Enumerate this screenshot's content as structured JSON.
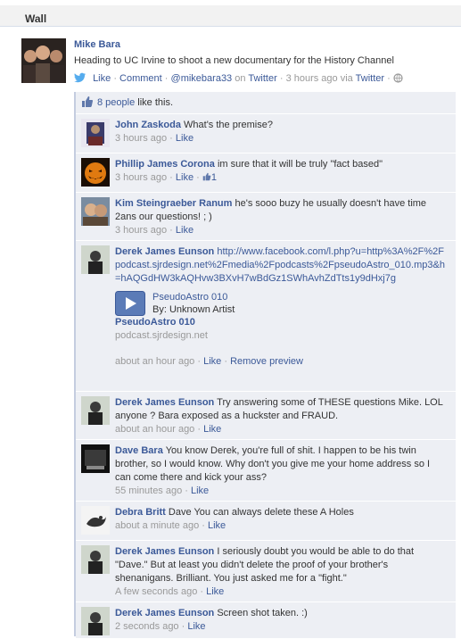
{
  "wall": {
    "title": "Wall"
  },
  "post": {
    "author": "Mike Bara",
    "text": "Heading to UC Irvine to shoot a new documentary for the History Channel",
    "like": "Like",
    "sep1": "·",
    "comment": "Comment",
    "sep2": "·",
    "source_handle": "@mikebara33",
    "source_on": "on",
    "source_site": "Twitter",
    "sep3": "·",
    "time": "3 hours ago via",
    "via": "Twitter",
    "sep4": "·"
  },
  "likes": {
    "count_link": "8 people",
    "suffix": "like this."
  },
  "comments": [
    {
      "author": "John Zaskoda",
      "text": "What's the premise?",
      "time": "3 hours ago",
      "like": "Like"
    },
    {
      "author": "Phillip James Corona",
      "text": "im sure that it will be truly \"fact based\"",
      "time": "3 hours ago",
      "like": "Like",
      "like_count": "1"
    },
    {
      "author": "Kim Steingraeber Ranum",
      "text": "he's sooo buzy he usually doesn't have time 2ans our questions! ; )",
      "time": "3 hours ago",
      "like": "Like"
    },
    {
      "author": "Derek James Eunson",
      "text": "http://www.facebook.com/l.php?u=http%3A%2F%2Fpodcast.sjrdesign.net%2Fmedia%2Fpodcasts%2FpseudoAstro_010.mp3&h=hAQGdHW3kAQHvw3BXvH7wBdGz1SWhAvhZdTts1y9dHxj7g",
      "share_title": "PseudoAstro 010",
      "share_artist": "By: Unknown Artist",
      "share_link": "PseudoAstro 010",
      "share_domain": "podcast.sjrdesign.net",
      "time": "about an hour ago",
      "like": "Like",
      "remove": "Remove preview"
    },
    {
      "author": "Derek James Eunson",
      "text": "Try answering some of THESE questions Mike. LOL anyone ? Bara exposed as a huckster and FRAUD.",
      "time": "about an hour ago",
      "like": "Like"
    },
    {
      "author": "Dave Bara",
      "text": "You know Derek, you're full of shit. I happen to be his twin brother, so I would know. Why don't you give me your home address so I can come there and kick your ass?",
      "time": "55 minutes ago",
      "like": "Like"
    },
    {
      "author": "Debra Britt",
      "text": "Dave You can always delete these A Holes",
      "time": "about a minute ago",
      "like": "Like"
    },
    {
      "author": "Derek James Eunson",
      "text": "I seriously doubt you would be able to do that \"Dave.\" But at least you didn't delete the proof of your brother's shenanigans. Brilliant. You just asked me for a \"fight.\"",
      "time": "A few seconds ago",
      "like": "Like"
    },
    {
      "author": "Derek James Eunson",
      "text": "Screen shot taken. :)",
      "time": "2 seconds ago",
      "like": "Like"
    }
  ],
  "colors": {
    "link": "#3b5998",
    "comment_bg": "#edeff4",
    "muted": "#999999"
  }
}
